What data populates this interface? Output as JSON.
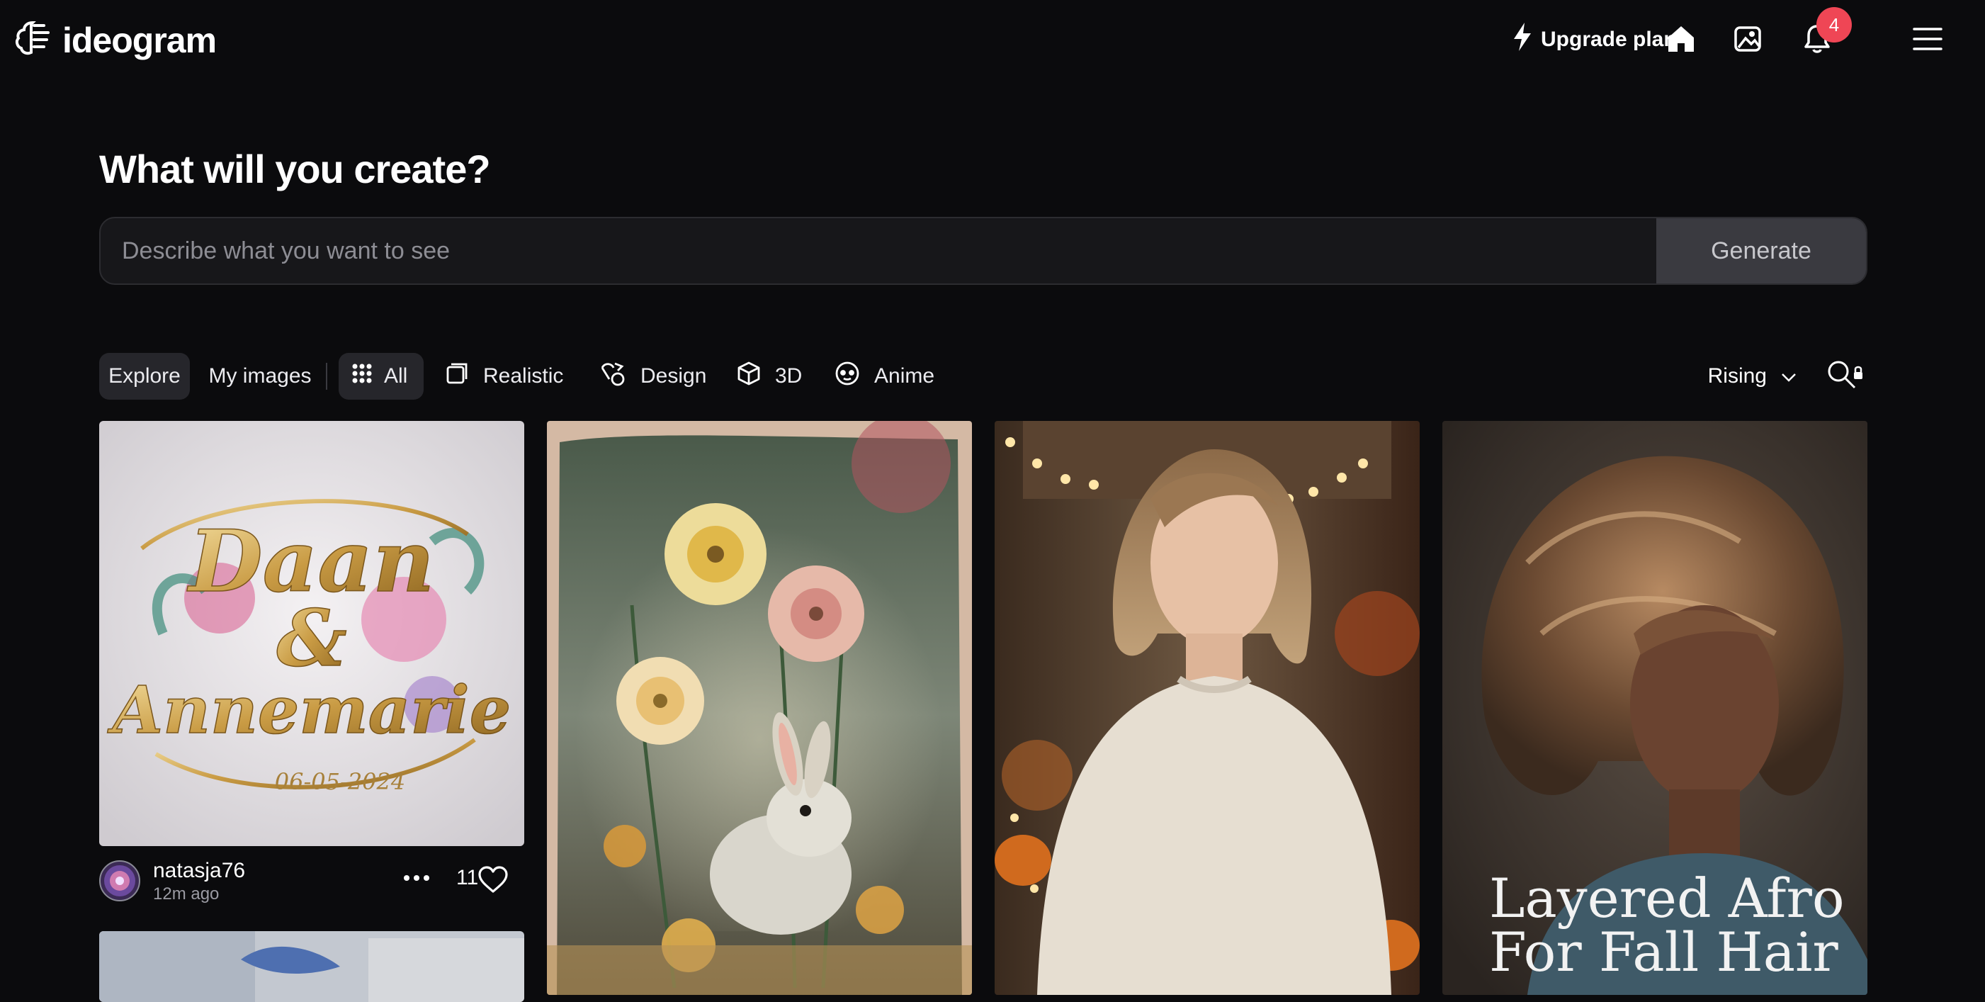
{
  "brand": {
    "name": "ideogram"
  },
  "header": {
    "upgrade_label": "Upgrade plan",
    "notification_count": "4",
    "icons": [
      "bolt-icon",
      "home-icon",
      "gallery-icon",
      "bell-icon",
      "menu-icon"
    ]
  },
  "hero": {
    "title": "What will you create?",
    "prompt_placeholder": "Describe what you want to see",
    "generate_label": "Generate"
  },
  "filters": {
    "tabs": [
      "Explore",
      "My images"
    ],
    "categories": [
      "All",
      "Realistic",
      "Design",
      "3D",
      "Anime"
    ],
    "active_tab": "Explore",
    "active_category": "All",
    "sort_label": "Rising"
  },
  "feed": {
    "cards": [
      {
        "username": "natasja76",
        "time": "12m ago",
        "likes": "11",
        "image_text": {
          "line1": "Daan",
          "amp": "&",
          "line2": "Annemarie",
          "date": "06-05-2024"
        }
      },
      {
        "subject": "rabbit-with-flowers"
      },
      {
        "subject": "woman-in-sweater"
      },
      {
        "image_text": {
          "line1": "Layered Afro",
          "line2": "For Fall Hair"
        }
      }
    ]
  },
  "colors": {
    "background": "#0b0b0d",
    "badge": "#ef4655",
    "surface": "#17171a"
  }
}
